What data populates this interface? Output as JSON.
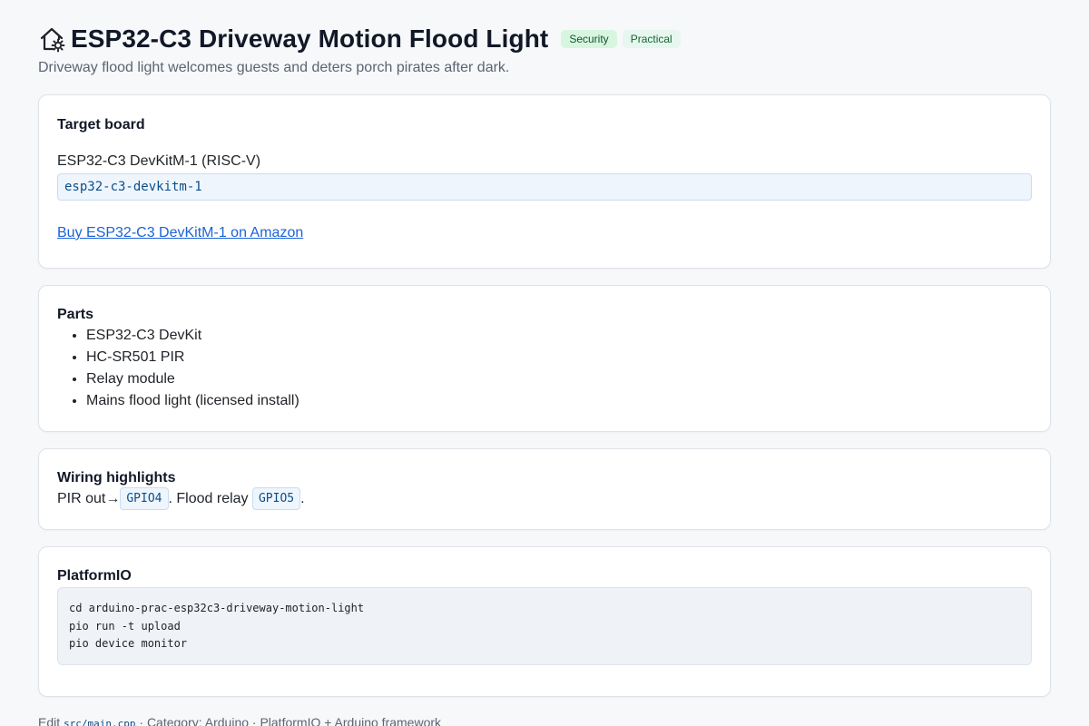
{
  "header": {
    "icon": "house-gear-icon",
    "title": "ESP32-C3 Driveway Motion Flood Light",
    "badges": [
      "Security",
      "Practical"
    ],
    "subtitle": "Driveway flood light welcomes guests and deters porch pirates after dark."
  },
  "target_board": {
    "heading": "Target board",
    "board_name": "ESP32-C3 DevKitM-1 (RISC-V)",
    "board_id": "esp32-c3-devkitm-1",
    "buy_link": "Buy ESP32-C3 DevKitM-1 on Amazon"
  },
  "parts": {
    "heading": "Parts",
    "items": [
      "ESP32-C3 DevKit",
      "HC-SR501 PIR",
      "Relay module",
      "Mains flood light (licensed install)"
    ]
  },
  "wiring": {
    "heading": "Wiring highlights",
    "text1": "PIR out→",
    "pin1": "GPIO4",
    "text2": ". Flood relay ",
    "pin2": "GPIO5",
    "text3": "."
  },
  "platformio": {
    "heading": "PlatformIO",
    "commands": [
      "cd arduino-prac-esp32c3-driveway-motion-light",
      "pio run -t upload",
      "pio device monitor"
    ]
  },
  "footer": {
    "edit_label": "Edit ",
    "file": "src/main.cpp",
    "rest": " · Category: Arduino · PlatformIO + Arduino framework"
  },
  "colors": {
    "accent_link": "#1d63d6",
    "code_text": "#0b4f8a",
    "badge_bg": "#d8f5e0"
  }
}
